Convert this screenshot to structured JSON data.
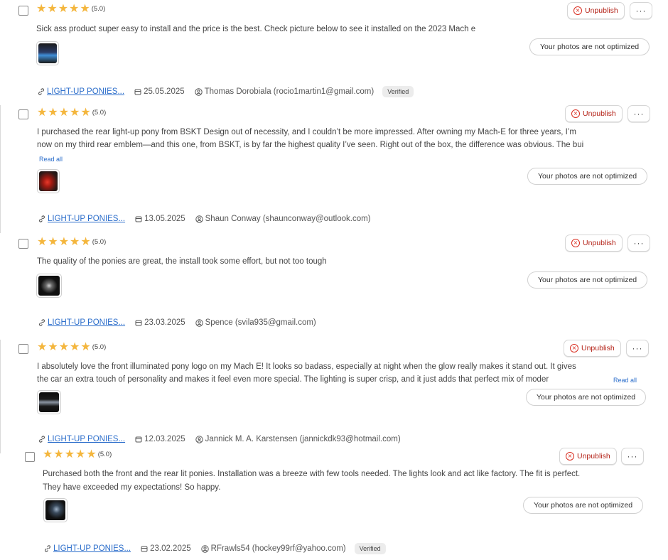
{
  "common": {
    "unpublish_label": "Unpublish",
    "more_label": "···",
    "not_optimized_label": "Your photos are not optimized",
    "read_all_label": "Read all",
    "verified_label": "Verified",
    "product_link": "LIGHT-UP PONIES...",
    "star_color": "#f4b63d",
    "link_color": "#2c6ecb",
    "unpublish_color": "#b42318"
  },
  "reviews": [
    {
      "stars": 5,
      "rating_text": "(5.0)",
      "body": "Sick ass product super easy to install and the price is the best. Check picture below to see it installed on the 2023 Mach e",
      "date": "25.05.2025",
      "author": "Thomas Dorobiala (rocio1martin1@gmail.com)",
      "verified": true
    },
    {
      "stars": 5,
      "rating_text": "(5.0)",
      "body_line1": "I purchased the rear light-up pony from BSKT Design out of necessity, and I couldn’t be more impressed. After owning my Mach-E for three years, I’m",
      "body_line2": "now on my third rear emblem—and this one, from BSKT, is by far the highest quality I’ve seen. Right out of the box, the difference was obvious. The bui",
      "date": "13.05.2025",
      "author": "Shaun Conway (shaunconway@outlook.com)",
      "verified": false
    },
    {
      "stars": 5,
      "rating_text": "(5.0)",
      "body": "The quality of the ponies are great, the install took some effort, but not too tough",
      "date": "23.03.2025",
      "author": "Spence (svila935@gmail.com)",
      "verified": false
    },
    {
      "stars": 5,
      "rating_text": "(5.0)",
      "body_line1": "I absolutely love the front illuminated pony logo on my Mach E! It looks so badass, especially at night when the glow really makes it stand out. It gives",
      "body_line2": "the car an extra touch of personality and makes it feel even more special. The lighting is super crisp, and it just adds that perfect mix of moder",
      "date": "12.03.2025",
      "author": "Jannick M. A. Karstensen (jannickdk93@hotmail.com)",
      "verified": false
    },
    {
      "stars": 5,
      "rating_text": "(5.0)",
      "body_line1": "Purchased both the front and the rear lit ponies. Installation was a breeze with few tools needed. The lights look and act like factory. The fit is perfect.",
      "body_line2": "They have exceeded my expectations! So happy.",
      "date": "23.02.2025",
      "author": "RFrawls54 (hockey99rf@yahoo.com)",
      "verified": true
    }
  ]
}
